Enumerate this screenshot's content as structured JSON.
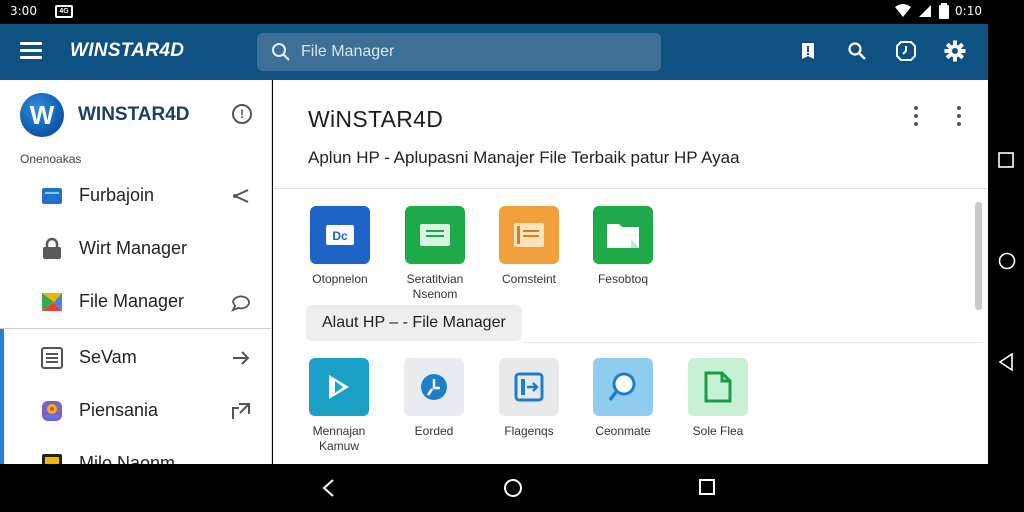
{
  "status_bar": {
    "time": "3:00",
    "clock": "0:10",
    "sim_label": "4G"
  },
  "app_bar": {
    "title": "WINSTAR4D",
    "search_placeholder": "File Manager",
    "actions": [
      "alert-icon",
      "search-icon",
      "clock-icon",
      "gear-icon"
    ]
  },
  "drawer": {
    "logo_letter": "W",
    "title": "WINSTAR4D",
    "section_label": "Onenoakas",
    "items": [
      {
        "label": "Furbajoin",
        "icon": "folder-icon",
        "trail": "share-icon",
        "color": "#1e72c8"
      },
      {
        "label": "Wirt Manager",
        "icon": "lock-icon",
        "trail": "",
        "color": "#5a5a5a"
      },
      {
        "label": "File Manager",
        "icon": "drive-icon",
        "trail": "chat-icon",
        "color": "#34a853"
      },
      {
        "label": "SeVam",
        "icon": "list-icon",
        "trail": "arrow-right-icon",
        "color": "#555555"
      },
      {
        "label": "Piensania",
        "icon": "badge-icon",
        "trail": "export-icon",
        "color": "#7a5fd1"
      },
      {
        "label": "Milo Naonm",
        "icon": "media-icon",
        "trail": "",
        "color": "#222222"
      }
    ]
  },
  "main": {
    "title": "WiNSTAR4D",
    "subtitle": "Aplun HP - Aplupasni Manajer File Terbaik patur HP Ayaa",
    "chip_label": "Alaut  HP – - File Manager",
    "row1": [
      {
        "label": "Otopnelon",
        "color": "#1e63c6",
        "icon": "card-icon"
      },
      {
        "label": "Seratitvian Nsenom",
        "color": "#1faa4a",
        "icon": "doc-icon"
      },
      {
        "label": "Comsteint",
        "color": "#f2a03d",
        "icon": "note-icon"
      },
      {
        "label": "Fesobtoq",
        "color": "#1faa4a",
        "icon": "folder-icon"
      }
    ],
    "row2": [
      {
        "label": "Mennajan Kamuw",
        "color": "#1a9fc7",
        "icon": "play-icon"
      },
      {
        "label": "Eorded",
        "color": "#e8ecf1",
        "icon": "compass-icon"
      },
      {
        "label": "Flagenqs",
        "color": "#e7e9ec",
        "icon": "import-icon"
      },
      {
        "label": "Ceonmate",
        "color": "#8ecdf0",
        "icon": "search-circle-icon"
      },
      {
        "label": "Sole Flea",
        "color": "#c8f0d3",
        "icon": "file-icon"
      }
    ]
  },
  "colors": {
    "app_bar": "#0e5181",
    "accent": "#2a7fd4"
  }
}
